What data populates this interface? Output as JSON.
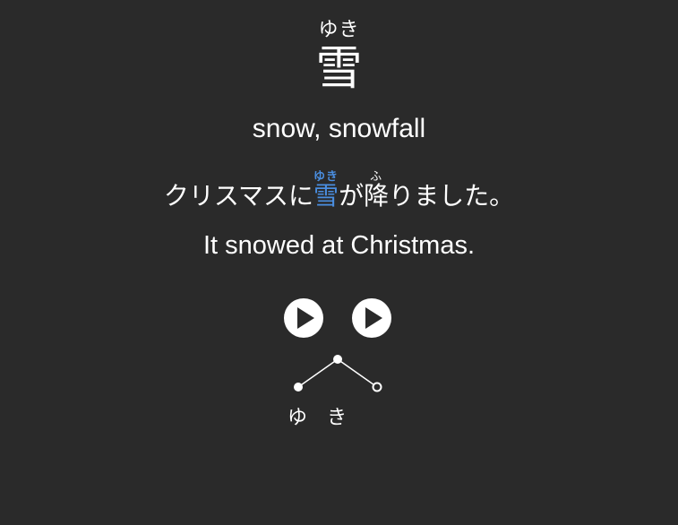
{
  "word": {
    "reading": "ゆき",
    "kanji": "雪",
    "meaning": "snow, snowfall"
  },
  "sentence": {
    "part1": "クリスマスに",
    "highlight_kanji": "雪",
    "highlight_reading": "ゆき",
    "part2": "が",
    "kanji2": "降",
    "kanji2_reading": "ふ",
    "part3": "りました。",
    "translation": "It snowed at Christmas."
  },
  "audio": {
    "word_button_icon": "play-icon",
    "sentence_button_icon": "play-icon"
  },
  "pitch_accent": {
    "morae": [
      "ゆ",
      "き"
    ],
    "pattern": [
      "low",
      "high",
      "low"
    ],
    "particle_marker": "hollow"
  },
  "colors": {
    "background": "#2a2a2a",
    "text": "#ffffff",
    "highlight": "#4a8ee0"
  }
}
